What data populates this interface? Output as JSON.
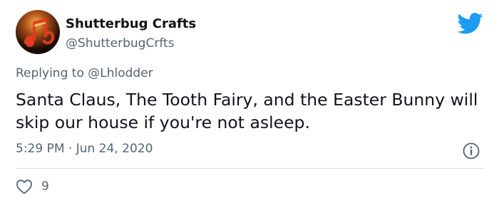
{
  "author": {
    "display_name": "Shutterbug Crafts",
    "handle": "@ShutterbugCrfts"
  },
  "reply": {
    "prefix": "Replying to",
    "mention": "@Lhlodder"
  },
  "tweet": {
    "text": "Santa Claus, The Tooth Fairy, and the Easter Bunny will skip our house if you're not asleep.",
    "time": "5:29 PM",
    "separator": "·",
    "date": "Jun 24, 2020"
  },
  "actions": {
    "like_count": "9"
  },
  "colors": {
    "twitter_blue": "#1d9bf0",
    "secondary_text": "#536471",
    "primary_text": "#0f1419",
    "divider": "#cfd9de"
  },
  "icons": {
    "brand": "twitter-bird-icon",
    "info": "info-icon",
    "like": "heart-icon"
  }
}
